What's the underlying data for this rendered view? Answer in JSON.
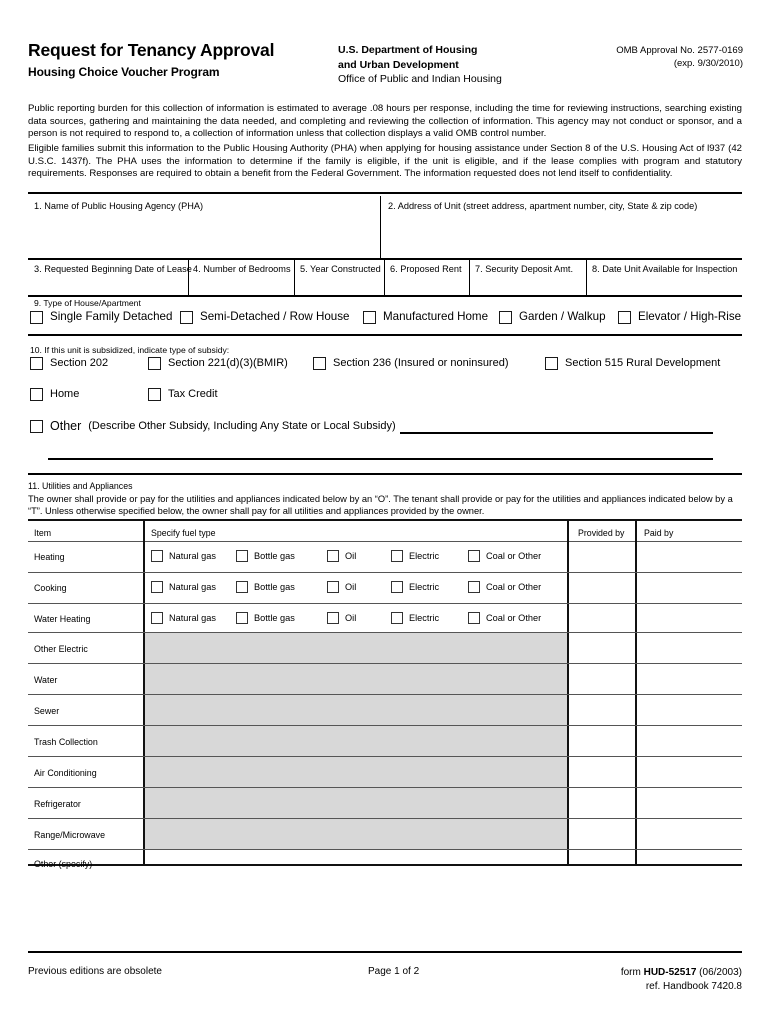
{
  "header": {
    "title": "Request for Tenancy Approval",
    "subtitle": "Housing Choice Voucher Program",
    "agency_line1": "U.S. Department of Housing",
    "agency_line2": "and Urban Development",
    "agency_line3": "Office of Public and Indian Housing",
    "omb_line1": "OMB Approval No. 2577-0169",
    "omb_line2": "(exp. 9/30/2010)"
  },
  "paragraphs": {
    "burden": "Public reporting burden for this collection of information is estimated to average .08 hours per response, including the time for reviewing instructions, searching existing data sources, gathering and maintaining the data needed, and completing and reviewing the collection of information.    This agency may not conduct or sponsor, and a person is not required to respond to, a collection of information unless that collection displays a valid OMB control number.",
    "eligible": "Eligible families submit this information to the Public Housing Authority (PHA) when applying for housing assistance under Section 8 of the U.S. Housing Act of l937 (42 U.S.C. 1437f).   The PHA uses the information  to determine if the family is eligible, if the unit is eligible, and if the lease complies with program and statutory requirements.    Responses are required to obtain a benefit from the Federal Government.  The information requested does not lend itself to confidentiality."
  },
  "fields": {
    "f1": "1. Name of Public Housing Agency (PHA)",
    "f2": "2. Address of Unit  (street address, apartment number, city, State & zip code)",
    "f3": "3. Requested Beginning Date of Lease",
    "f4": "4.   Number of Bedrooms",
    "f5": "5. Year Constructed",
    "f6": "6.  Proposed Rent",
    "f7": "7.  Security Deposit Amt.",
    "f8": "8. Date Unit Available for Inspection"
  },
  "section9": {
    "heading": "9.  Type of House/Apartment",
    "options": [
      "Single Family Detached",
      "Semi-Detached / Row House",
      "Manufactured Home",
      "Garden / Walkup",
      "Elevator / High-Rise"
    ]
  },
  "section10": {
    "heading": "10. If this unit is subsidized, indicate type of subsidy:",
    "row1": [
      "Section 202",
      "Section 221(d)(3)(BMIR)",
      "Section 236 (Insured or noninsured)",
      "Section 515 Rural Development"
    ],
    "row2": [
      "Home",
      "Tax Credit"
    ],
    "other_label": "Other",
    "other_desc": "(Describe Other Subsidy, Including Any State or Local Subsidy)"
  },
  "section11": {
    "heading": "11. Utilities and Appliances",
    "instructions": "The owner shall provide or pay for the utilities and appliances indicated below by an “O”.  The tenant shall provide or pay for the utilities and appliances indicated below by a “T”.  Unless otherwise specified below, the owner shall pay for all utilities and appliances provided by the owner.",
    "columns": {
      "item": "Item",
      "fuel": "Specify fuel type",
      "provided_by": "Provided by",
      "paid_by": "Paid by"
    },
    "fuel_options": [
      "Natural gas",
      "Bottle gas",
      "Oil",
      "Electric",
      "Coal or Other"
    ],
    "rows": [
      {
        "label": "Heating",
        "has_fuel": true,
        "shaded": false
      },
      {
        "label": "Cooking",
        "has_fuel": true,
        "shaded": false
      },
      {
        "label": "Water Heating",
        "has_fuel": true,
        "shaded": false
      },
      {
        "label": "Other Electric",
        "has_fuel": false,
        "shaded": true
      },
      {
        "label": "Water",
        "has_fuel": false,
        "shaded": true
      },
      {
        "label": "Sewer",
        "has_fuel": false,
        "shaded": true
      },
      {
        "label": "Trash Collection",
        "has_fuel": false,
        "shaded": true
      },
      {
        "label": "Air Conditioning",
        "has_fuel": false,
        "shaded": true
      },
      {
        "label": "Refrigerator",
        "has_fuel": false,
        "shaded": true
      },
      {
        "label": "Range/Microwave",
        "has_fuel": false,
        "shaded": true
      },
      {
        "label": "Other (specify)",
        "has_fuel": false,
        "shaded": false
      }
    ]
  },
  "footer": {
    "left": "Previous editions are obsolete",
    "page": "Page 1 of 2",
    "form_prefix": "form ",
    "form_number": "HUD-52517",
    "form_date": "  (06/2003)",
    "ref": "ref. Handbook 7420.8"
  },
  "colors": {
    "shaded_cell": "#d8d8d8",
    "rule": "#000000",
    "grid_line": "#555555"
  }
}
